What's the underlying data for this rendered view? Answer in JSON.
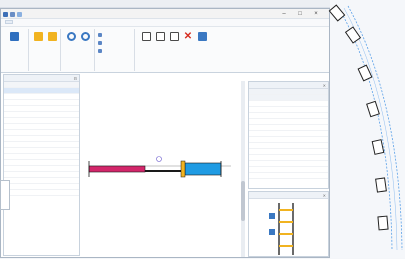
{
  "window": {
    "title": "",
    "controls": {
      "minimize": "–",
      "maximize": "□",
      "close": "×"
    },
    "tab_label": ""
  },
  "ribbon": {
    "groups": [
      {
        "name": "",
        "buttons": [
          {
            "label": "",
            "color": "#2f6fbf"
          }
        ]
      },
      {
        "name": "",
        "buttons": [
          {
            "label": "",
            "color": "#f1b320"
          },
          {
            "label": "",
            "color": "#f1b320"
          }
        ]
      },
      {
        "name": "",
        "buttons": [
          {
            "label": "",
            "color": "#3a78c2"
          },
          {
            "label": "",
            "color": "#3a78c2"
          }
        ]
      },
      {
        "name": "",
        "rows": [
          "",
          "",
          ""
        ]
      },
      {
        "name": "",
        "buttons": [
          {
            "label": "",
            "color": "#4a4a4a"
          },
          {
            "label": "",
            "color": "#4a4a4a"
          },
          {
            "label": "",
            "color": "#4a4a4a"
          },
          {
            "label": "",
            "color": "#d62d20"
          },
          {
            "label": "",
            "color": "#3a78c2"
          }
        ]
      }
    ]
  },
  "left_panel": {
    "title": "",
    "col1": "",
    "col2": "",
    "rows": [
      {
        "k": "",
        "v": ""
      },
      {
        "k": "",
        "v": ""
      },
      {
        "k": "",
        "v": ""
      },
      {
        "k": "",
        "v": ""
      },
      {
        "k": "",
        "v": ""
      },
      {
        "k": "",
        "v": ""
      },
      {
        "k": "",
        "v": ""
      },
      {
        "k": "",
        "v": ""
      },
      {
        "k": "",
        "v": ""
      },
      {
        "k": "",
        "v": ""
      },
      {
        "k": "",
        "v": ""
      },
      {
        "k": "",
        "v": ""
      },
      {
        "k": "",
        "v": ""
      },
      {
        "k": "",
        "v": ""
      },
      {
        "k": "",
        "v": ""
      },
      {
        "k": "",
        "v": ""
      },
      {
        "k": "",
        "v": ""
      },
      {
        "k": "",
        "v": ""
      }
    ]
  },
  "prop_panel": {
    "title": "",
    "section1": "",
    "section2": "",
    "rows": [
      {
        "k": "",
        "v": ""
      },
      {
        "k": "",
        "v": ""
      },
      {
        "k": "",
        "v": ""
      },
      {
        "k": "",
        "v": ""
      },
      {
        "k": "",
        "v": ""
      },
      {
        "k": "",
        "v": ""
      },
      {
        "k": "",
        "v": ""
      },
      {
        "k": "",
        "v": ""
      },
      {
        "k": "",
        "v": ""
      },
      {
        "k": "",
        "v": ""
      },
      {
        "k": "",
        "v": ""
      },
      {
        "k": "",
        "v": ""
      },
      {
        "k": "",
        "v": ""
      }
    ]
  },
  "bottom_right_panel": {
    "title": ""
  },
  "canvas": {
    "bar_colors": {
      "left": "#d3266a",
      "right": "#1f9be3",
      "outline": "#1a1a1a"
    }
  },
  "right_page": {
    "tags": [
      "",
      "",
      "",
      "",
      "",
      "",
      ""
    ]
  }
}
